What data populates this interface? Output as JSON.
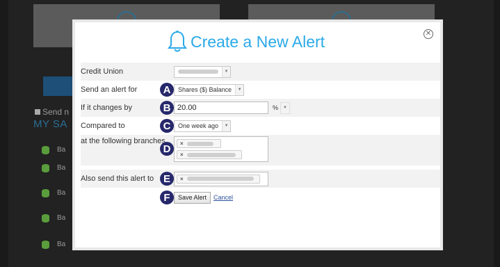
{
  "background": {
    "send_label": "Send n",
    "section_title": "MY SA",
    "row_labels": [
      "Ba",
      "Ba",
      "Ba",
      "Ba",
      "Ba"
    ]
  },
  "modal": {
    "title": "Create a New Alert",
    "close_icon": "circle-x-icon",
    "fields": {
      "credit_union": {
        "label": "Credit Union"
      },
      "send_alert_for": {
        "label": "Send an alert for",
        "badge": "A",
        "value": "Shares ($) Balance"
      },
      "if_changes_by": {
        "label": "If it changes by",
        "badge": "B",
        "value": "20.00",
        "unit": "%"
      },
      "compared_to": {
        "label": "Compared to",
        "badge": "C",
        "value": "One week ago"
      },
      "branches": {
        "label": "at the following branches",
        "badge": "D",
        "tag_remove": "×"
      },
      "also_send": {
        "label": "Also send this alert to",
        "badge": "E",
        "tag_remove": "×"
      },
      "actions": {
        "badge": "F",
        "save_label": "Save Alert",
        "cancel_label": "Cancel"
      }
    },
    "accent_color": "#2aa9e8",
    "badge_color": "#26286b"
  }
}
